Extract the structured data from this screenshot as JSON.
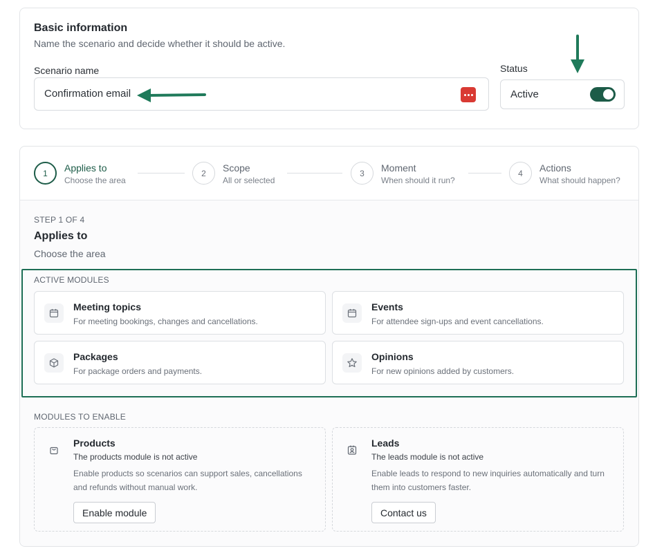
{
  "basic_info": {
    "title": "Basic information",
    "subtitle": "Name the scenario and decide whether it should be active.",
    "scenario_name_label": "Scenario name",
    "scenario_name_value": "Confirmation email",
    "password_manager_icon": "dots-icon",
    "status_label": "Status",
    "status_value": "Active",
    "status_toggle_on": true
  },
  "annotations": {
    "arrow_color": "#1f7a5a"
  },
  "stepper": {
    "steps": [
      {
        "number": "1",
        "title": "Applies to",
        "subtitle": "Choose the area",
        "active": true
      },
      {
        "number": "2",
        "title": "Scope",
        "subtitle": "All or selected",
        "active": false
      },
      {
        "number": "3",
        "title": "Moment",
        "subtitle": "When should it run?",
        "active": false
      },
      {
        "number": "4",
        "title": "Actions",
        "subtitle": "What should happen?",
        "active": false
      }
    ]
  },
  "step_content": {
    "step_counter": "STEP 1 OF 4",
    "title": "Applies to",
    "subtitle": "Choose the area",
    "active_modules_heading": "ACTIVE MODULES",
    "active_modules": [
      {
        "title": "Meeting topics",
        "description": "For meeting bookings, changes and cancellations.",
        "icon": "calendar-icon"
      },
      {
        "title": "Events",
        "description": "For attendee sign-ups and event cancellations.",
        "icon": "calendar-icon"
      },
      {
        "title": "Packages",
        "description": "For package orders and payments.",
        "icon": "package-icon"
      },
      {
        "title": "Opinions",
        "description": "For new opinions added by customers.",
        "icon": "star-icon"
      }
    ],
    "modules_to_enable_heading": "MODULES TO ENABLE",
    "modules_to_enable": [
      {
        "title": "Products",
        "status": "The products module is not active",
        "description": "Enable products so scenarios can support sales, cancellations and refunds without manual work.",
        "button": "Enable module",
        "icon": "shopping-bag-icon"
      },
      {
        "title": "Leads",
        "status": "The leads module is not active",
        "description": "Enable leads to respond to new inquiries automatically and turn them into customers faster.",
        "button": "Contact us",
        "icon": "contact-badge-icon"
      }
    ]
  },
  "colors": {
    "accent": "#1d5c48",
    "highlight_border": "#1d6e55",
    "password_icon": "#d93a33"
  }
}
